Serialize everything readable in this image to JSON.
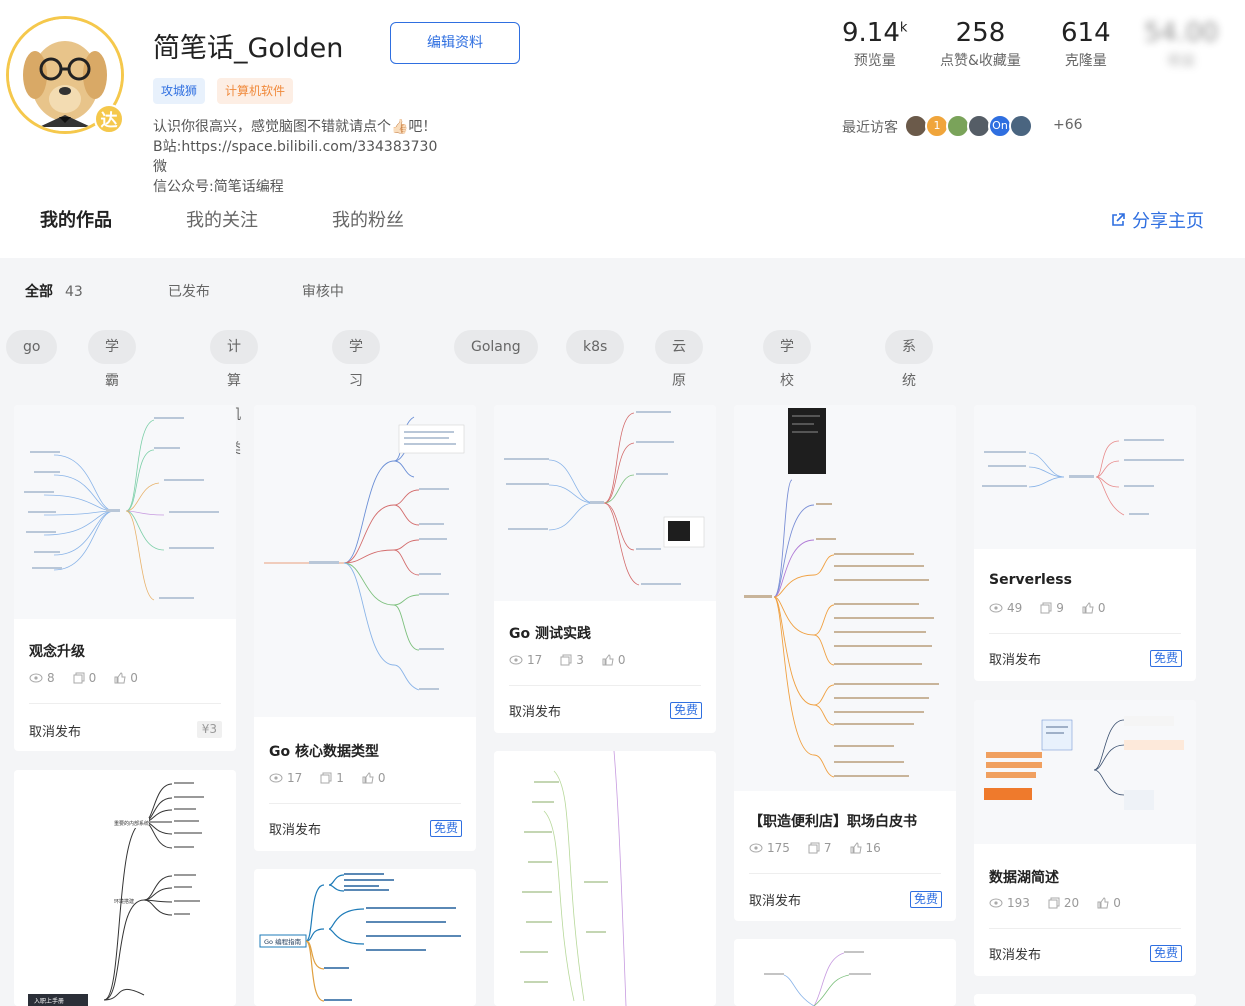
{
  "profile": {
    "username": "简笔话_Golden",
    "edit_button": "编辑资料",
    "badge": "达",
    "tags": [
      "攻城狮",
      "计算机软件"
    ],
    "bio_line1": "认识你很高兴，感觉脑图不错就请点个👍🏻吧！",
    "bio_line2": "B站:https://space.bilibili.com/334383730 微",
    "bio_line3": "信公众号:简笔话编程"
  },
  "stats": [
    {
      "value": "9.14",
      "suffix": "k",
      "label": "预览量"
    },
    {
      "value": "258",
      "suffix": "",
      "label": "点赞&收藏量"
    },
    {
      "value": "614",
      "suffix": "",
      "label": "克隆量"
    },
    {
      "value": "54.00",
      "suffix": "",
      "label": "收益"
    }
  ],
  "visitors": {
    "label": "最近访客",
    "more": "+66",
    "avatars": [
      {
        "text": "",
        "color": "#6b5a4a"
      },
      {
        "text": "1",
        "color": "#f0a53b"
      },
      {
        "text": "",
        "color": "#7aa35a"
      },
      {
        "text": "",
        "color": "#555d66"
      },
      {
        "text": "On",
        "color": "#2f6fe0"
      },
      {
        "text": "",
        "color": "#4a6580"
      }
    ]
  },
  "tabs": [
    "我的作品",
    "我的关注",
    "我的粉丝"
  ],
  "share": "分享主页",
  "filters": {
    "all": "全部",
    "all_count": "43",
    "published": "已发布",
    "reviewing": "审核中"
  },
  "chips": [
    "go",
    "学霸笔记",
    "计算机类",
    "学习笔记",
    "Golang",
    "k8s",
    "云原生",
    "学校教育",
    "系统设计"
  ],
  "cards": [
    {
      "title": "观念升级",
      "views": "8",
      "clones": "0",
      "likes": "0",
      "action": "取消发布",
      "price": "¥3",
      "free": false
    },
    {
      "title": "Go 核心数据类型",
      "views": "17",
      "clones": "1",
      "likes": "0",
      "action": "取消发布",
      "price": "免费",
      "free": true
    },
    {
      "title": "Go 测试实践",
      "views": "17",
      "clones": "3",
      "likes": "0",
      "action": "取消发布",
      "price": "免费",
      "free": true
    },
    {
      "title": "【职造便利店】职场白皮书",
      "views": "175",
      "clones": "7",
      "likes": "16",
      "action": "取消发布",
      "price": "免费",
      "free": true
    },
    {
      "title": "Serverless",
      "views": "49",
      "clones": "9",
      "likes": "0",
      "action": "取消发布",
      "price": "免费",
      "free": true
    },
    {
      "title": "数据湖简述",
      "views": "193",
      "clones": "20",
      "likes": "0",
      "action": "取消发布",
      "price": "免费",
      "free": true
    }
  ],
  "thumb_labels": {
    "go_guide": "Go 编程指南",
    "rumen": "入职上手册",
    "neibu": "重要的内部系统",
    "huanjing": "环境搭建"
  },
  "colors": {
    "accent": "#2f6fe0",
    "avatar_ring": "#f5c84c",
    "tag_orange": "#f08a3c"
  }
}
